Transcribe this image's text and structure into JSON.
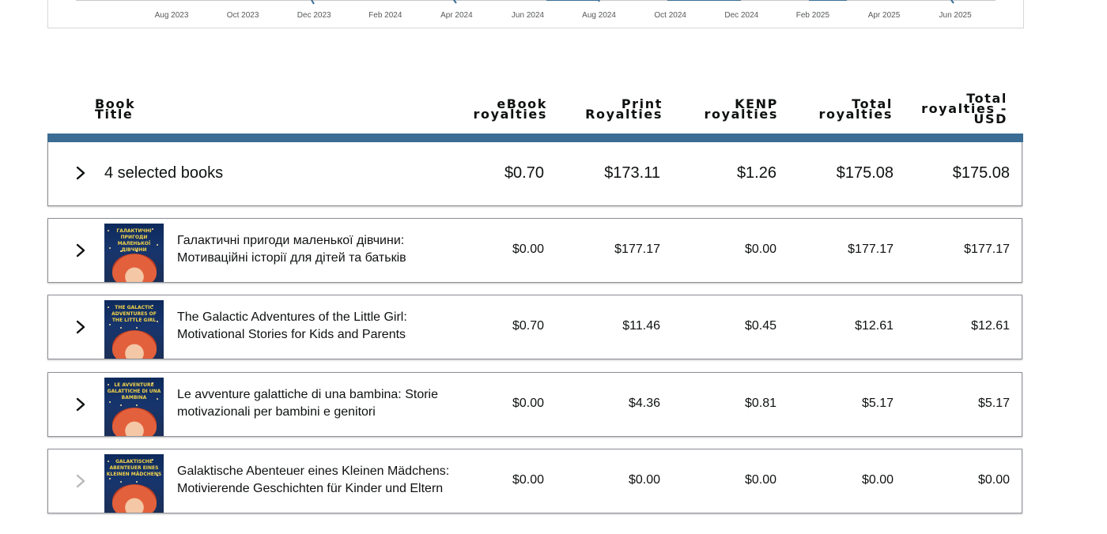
{
  "chart": {
    "x_ticks": [
      "Aug 2023",
      "Oct 2023",
      "Dec 2023",
      "Feb 2024",
      "Apr 2024",
      "Jun 2024",
      "Aug 2024",
      "Oct 2024",
      "Dec 2024",
      "Feb 2025",
      "Apr 2025",
      "Jun 2025"
    ],
    "colors": {
      "axis": "#8d9096",
      "series": "#3b6d94"
    }
  },
  "table": {
    "headers": {
      "title": [
        "Book",
        "Title"
      ],
      "ebook": [
        "eBook",
        "royalties"
      ],
      "print": [
        "Print",
        "Royalties"
      ],
      "kenp": [
        "KENP",
        "royalties"
      ],
      "total": [
        "Total",
        "royalties"
      ],
      "total_usd": [
        "Total",
        "royalties -",
        "USD"
      ]
    },
    "header_bar_color": "#3b6d94",
    "summary": {
      "label": "4 selected books",
      "ebook": "$0.70",
      "print": "$173.11",
      "kenp": "$1.26",
      "total": "$175.08",
      "total_usd": "$175.08"
    },
    "books": [
      {
        "title": [
          "Галактичні пригоди маленької дівчини:",
          "Мотиваційні історії для дітей та батьків"
        ],
        "cover_text": "Галактичні пригоди маленької дівчини",
        "ebook": "$0.00",
        "print": "$177.17",
        "kenp": "$0.00",
        "total": "$177.17",
        "total_usd": "$177.17",
        "expand_enabled": true
      },
      {
        "title": [
          "The Galactic Adventures of the Little Girl:",
          "Motivational Stories for Kids and Parents"
        ],
        "cover_text": "The Galactic Adventures of the Little Girl",
        "ebook": "$0.70",
        "print": "$11.46",
        "kenp": "$0.45",
        "total": "$12.61",
        "total_usd": "$12.61",
        "expand_enabled": true
      },
      {
        "title": [
          "Le avventure galattiche di una bambina: Storie",
          "motivazionali per bambini e genitori"
        ],
        "cover_text": "Le avventure galattiche di una bambina",
        "ebook": "$0.00",
        "print": "$4.36",
        "kenp": "$0.81",
        "total": "$5.17",
        "total_usd": "$5.17",
        "expand_enabled": true
      },
      {
        "title": [
          "Galaktische Abenteuer eines Kleinen Mädchens:",
          "Motivierende Geschichten für Kinder und Eltern"
        ],
        "cover_text": "Galaktische Abenteuer eines Kleinen Mädchens",
        "ebook": "$0.00",
        "print": "$0.00",
        "kenp": "$0.00",
        "total": "$0.00",
        "total_usd": "$0.00",
        "expand_enabled": false
      }
    ]
  }
}
